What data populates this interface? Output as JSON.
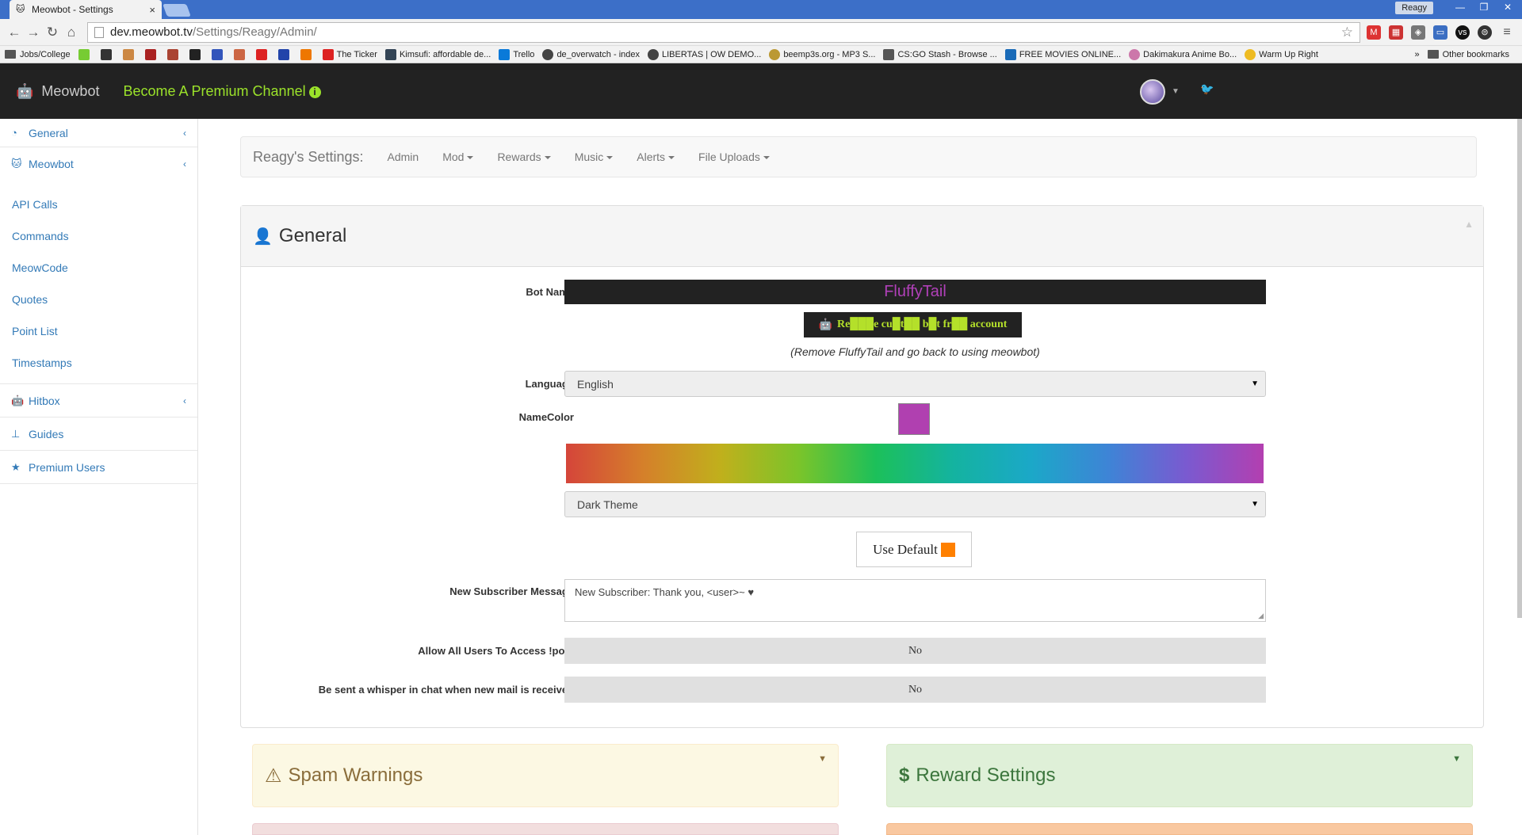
{
  "browser": {
    "tab_title": "Meowbot - Settings",
    "tab_close": "×",
    "user_badge": "Reagy",
    "url_host": "dev.meowbot.tv",
    "url_path": "/Settings/Reagy/Admin/",
    "bookmarks": [
      "Jobs/College",
      "The Ticker",
      "Kimsufi: affordable de...",
      "Trello",
      "de_overwatch - index",
      "LIBERTAS | OW DEMO...",
      "beemp3s.org - MP3 S...",
      "CS:GO Stash - Browse ...",
      "FREE MOVIES ONLINE...",
      "Dakimakura Anime Bo...",
      "Warm Up Right"
    ],
    "more_bookmarks": "»",
    "other_bookmarks": "Other bookmarks"
  },
  "appnav": {
    "brand": "Meowbot",
    "premium": "Become A Premium Channel",
    "premium_icon": "i"
  },
  "sidebar": {
    "items": [
      {
        "label": "General",
        "icon": "dashboard-icon"
      },
      {
        "label": "Meowbot",
        "icon": "meowbot-icon"
      }
    ],
    "sub_items": [
      "API Calls",
      "Commands",
      "MeowCode",
      "Quotes",
      "Point List",
      "Timestamps"
    ],
    "bottom_items": [
      {
        "label": "Hitbox",
        "icon": "android-icon"
      },
      {
        "label": "Guides",
        "icon": "sitemap-icon"
      },
      {
        "label": "Premium Users",
        "icon": "star-icon"
      }
    ]
  },
  "settings_bar": {
    "title": "Reagy's Settings:",
    "items": [
      "Admin",
      "Mod",
      "Rewards",
      "Music",
      "Alerts",
      "File Uploads"
    ]
  },
  "general": {
    "title": "General",
    "bot_name_label": "Bot Name",
    "bot_name_value": "FluffyTail",
    "remove_button": "Re███e cu█t██ b█t fr██ account",
    "remove_note": "(Remove FluffyTail and go back to using meowbot)",
    "language_label": "Language",
    "language_value": "English",
    "namecolor_label": "NameColor",
    "swatch_color": "#b040b0",
    "theme_value": "Dark Theme",
    "use_default": "Use Default",
    "new_sub_label": "New Subscriber Message",
    "new_sub_value": "New Subscriber: Thank you, <user>~ ♥",
    "allow_post_label": "Allow All Users To Access !post",
    "allow_post_value": "No",
    "whisper_label": "Be sent a whisper in chat when new mail is received",
    "whisper_value": "No"
  },
  "panels": {
    "spam_warnings": "Spam Warnings",
    "reward_settings": "Reward Settings"
  }
}
